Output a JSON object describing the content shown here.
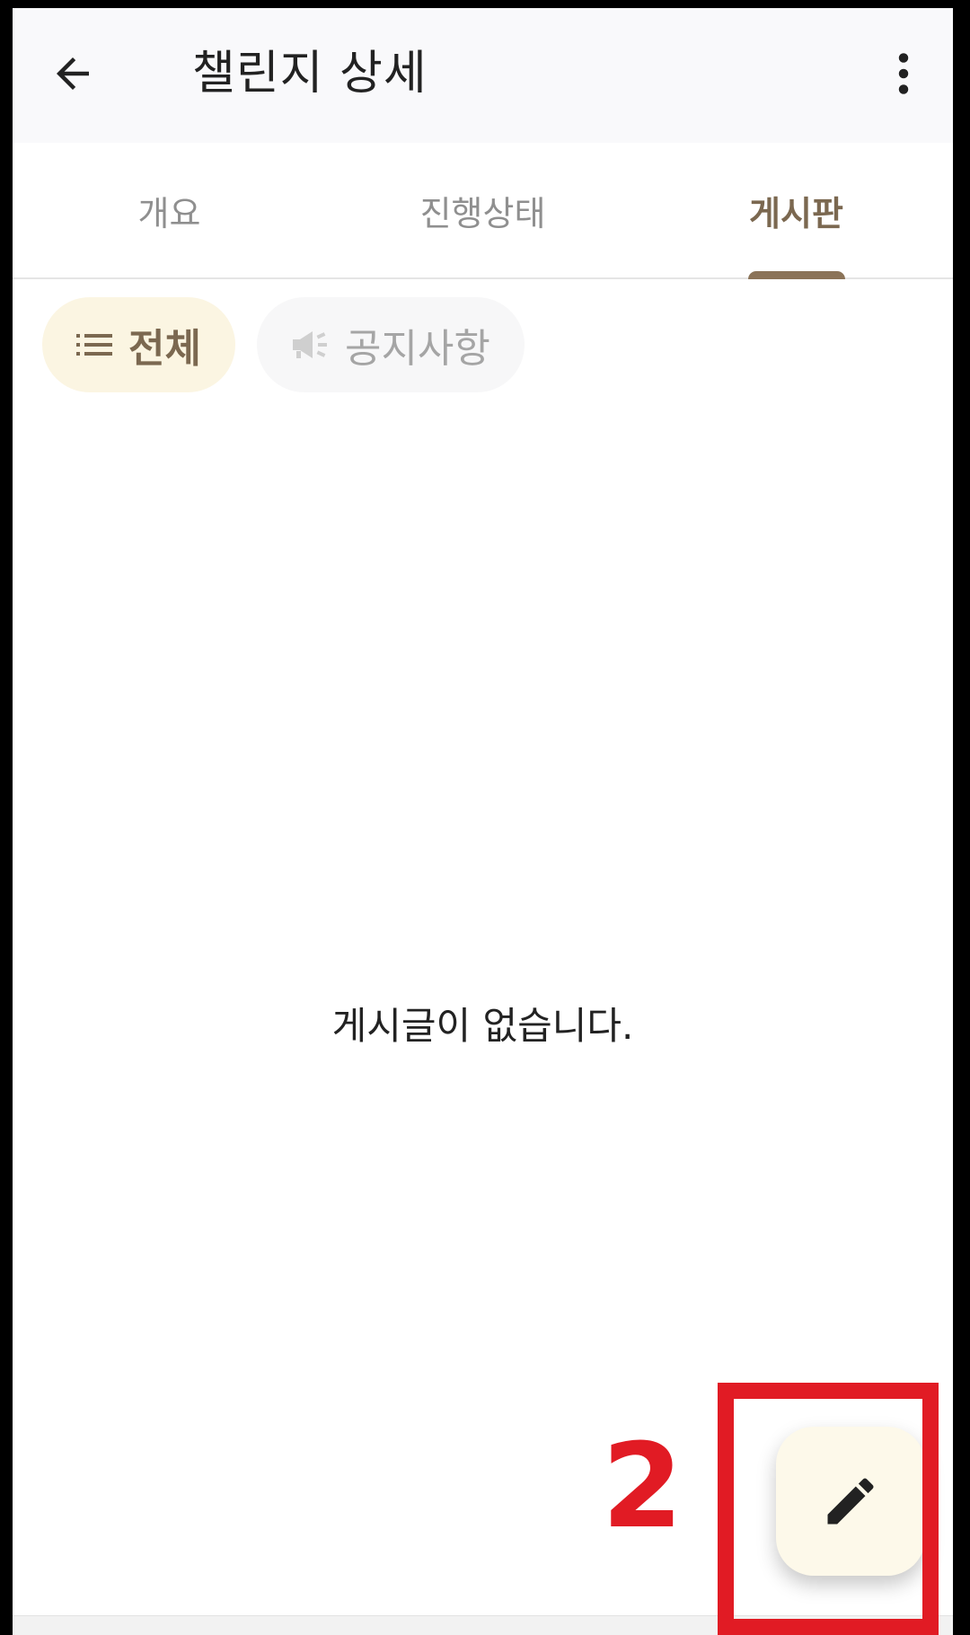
{
  "appbar": {
    "title": "챌린지 상세",
    "back_icon": "arrow-left-icon",
    "more_icon": "more-vertical-icon"
  },
  "tabs": [
    {
      "label": "개요",
      "active": false
    },
    {
      "label": "진행상태",
      "active": false
    },
    {
      "label": "게시판",
      "active": true
    }
  ],
  "filters": [
    {
      "label": "전체",
      "icon": "list-icon",
      "selected": true
    },
    {
      "label": "공지사항",
      "icon": "megaphone-icon",
      "selected": false
    }
  ],
  "empty_message": "게시글이 없습니다.",
  "fab": {
    "icon": "pencil-icon"
  },
  "annotation": {
    "number": "2"
  },
  "colors": {
    "accent": "#8b7358",
    "chip_selected_bg": "#fbf5e2",
    "fab_bg": "#fdf9ea",
    "annotation_red": "#e11b24"
  }
}
